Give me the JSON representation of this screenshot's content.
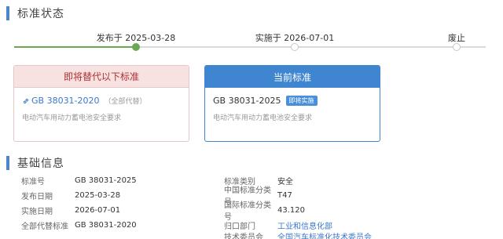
{
  "status_section": {
    "title": "标准状态"
  },
  "timeline": [
    {
      "label": "发布于 2025-03-28",
      "state": "active"
    },
    {
      "label": "实施于 2026-07-01",
      "state": "pending"
    },
    {
      "label": "废止",
      "state": "pending"
    }
  ],
  "replaced_card": {
    "header": "即将替代以下标准",
    "code": "GB 38031-2020",
    "scope": "（全部代替）",
    "description": "电动汽车用动力蓄电池安全要求",
    "icon": "link-icon"
  },
  "current_card": {
    "header": "当前标准",
    "code": "GB 38031-2025",
    "badge": "即将实施",
    "description": "电动汽车用动力蓄电池安全要求"
  },
  "basic_section": {
    "title": "基础信息"
  },
  "basic_info": {
    "left": [
      {
        "label": "标准号",
        "value": "GB 38031-2025"
      },
      {
        "label": "发布日期",
        "value": "2025-03-28"
      },
      {
        "label": "实施日期",
        "value": "2026-07-01"
      },
      {
        "label": "全部代替标准",
        "value": "GB 38031-2020"
      }
    ],
    "right": [
      {
        "label": "标准类别",
        "value": "安全"
      },
      {
        "label": "中国标准分类号",
        "value": "T47"
      },
      {
        "label": "国际标准分类号",
        "value": "43.120"
      },
      {
        "label": "归口部门",
        "value": "工业和信息化部"
      },
      {
        "label": "技术委员会",
        "value": "全国汽车标准化技术委员会"
      }
    ]
  },
  "colors": {
    "accent": "#3f85cf",
    "timeline_done": "#6aa84f",
    "replaced_header_bg": "#f7e1e1",
    "replaced_header_text": "#b03030"
  }
}
